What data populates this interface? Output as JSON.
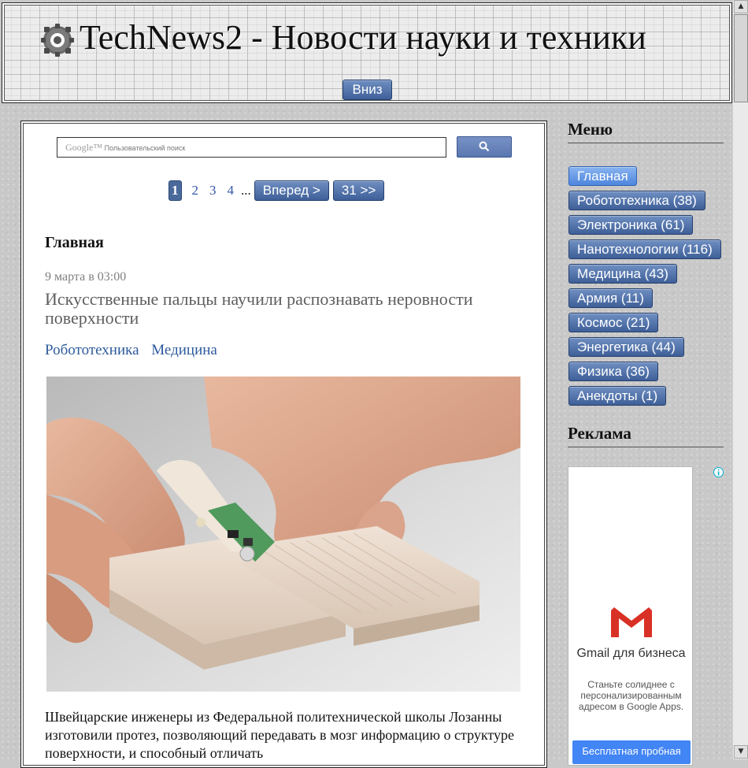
{
  "header": {
    "title": "TechNews2 - Новости науки и техники",
    "down_button": "Вниз"
  },
  "search": {
    "google_brand": "Google™",
    "placeholder": "Пользовательский поиск"
  },
  "pagination": {
    "current": "1",
    "pages": [
      "2",
      "3",
      "4"
    ],
    "ellipsis": "...",
    "next": "Вперед >",
    "last": "31 >>"
  },
  "main": {
    "heading": "Главная",
    "post": {
      "date": "9 марта в 03:00",
      "title": "Искусственные пальцы научили распознавать неровности поверхности",
      "tags": [
        "Робототехника",
        "Медицина"
      ],
      "text": "Швейцарские инженеры из Федеральной политехнической школы Лозанны изготовили протез, позволяющий передавать в мозг информацию о структуре поверхности, и способный отличать"
    }
  },
  "sidebar": {
    "menu_title": "Меню",
    "menu": [
      {
        "label": "Главная",
        "active": true
      },
      {
        "label": "Робототехника (38)"
      },
      {
        "label": "Электроника (61)"
      },
      {
        "label": "Нанотехнологии (116)"
      },
      {
        "label": "Медицина (43)"
      },
      {
        "label": "Армия (11)"
      },
      {
        "label": "Космос (21)"
      },
      {
        "label": "Энергетика (44)"
      },
      {
        "label": "Физика (36)"
      },
      {
        "label": "Анекдоты (1)"
      }
    ],
    "ad_title": "Реклама",
    "ad": {
      "title": "Gmail для бизнеса",
      "text": "Станьте солиднее с персонализированным адресом в Google Apps.",
      "button": "Бесплатная пробная"
    }
  },
  "colors": {
    "button_blue": "#4a6a9c",
    "active_blue": "#4d86dd",
    "link": "#2d5a9c",
    "gmail_red": "#d93025"
  },
  "icons": [
    "gear-logo-icon",
    "search-icon",
    "gmail-icon",
    "ad-info-icon",
    "scroll-up-icon",
    "scroll-down-icon"
  ]
}
